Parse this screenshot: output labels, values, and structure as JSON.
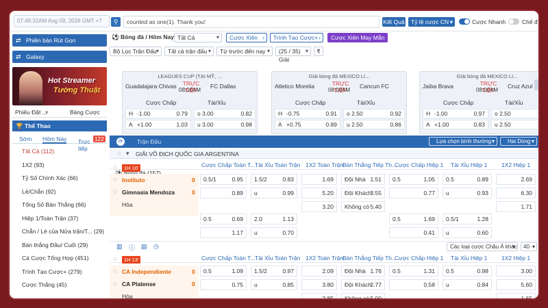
{
  "topbar": {
    "time": "07:46:32AM Aug 09, 2026 GMT +7",
    "search_text": "counted as one(1). Thank you!",
    "results_btn": "Kết Quả",
    "odds_select": "Tỷ lệ cược CN",
    "quick_bet": "Cược Nhanh",
    "mode_label": "Chế đ"
  },
  "sidebar": {
    "btn1": "Phiên bản Rút Gọn",
    "btn2": "Galaxy",
    "banner_line1": "Hot Streamer",
    "banner_line2": "Tường Thuật",
    "tab_slip": "Phiếu Đặt ...",
    "tab_table": "Bảng Cược",
    "sport_header": "Thể Thao",
    "subtab_early": "Sớm",
    "subtab_today": "Hôm Nay",
    "subtab_live": "Trực tiếp",
    "live_badge": "122",
    "menu": [
      {
        "label": "Bóng đá (157)",
        "kind": "main"
      },
      {
        "label": "Tất Cả (112)",
        "kind": "sub"
      },
      {
        "label": "1X2 (93)",
        "kind": "item"
      },
      {
        "label": "Tỷ Số Chính Xác (66)",
        "kind": "item"
      },
      {
        "label": "Lẻ/Chẵn (92)",
        "kind": "item"
      },
      {
        "label": "Tổng Số Bàn Thắng (66)",
        "kind": "item"
      },
      {
        "label": "Hiệp 1/Toàn Trận (37)",
        "kind": "item"
      },
      {
        "label": "Chẵn / Lẻ của Nửa trận/T... (29)",
        "kind": "item"
      },
      {
        "label": "Bàn thắng Đầu/ Cuối (29)",
        "kind": "item"
      },
      {
        "label": "Cá Cược Tổng Hợp (451)",
        "kind": "item"
      },
      {
        "label": "Trình Tạo Cược+ (279)",
        "kind": "item"
      },
      {
        "label": "Cược Thắng (45)",
        "kind": "item"
      }
    ]
  },
  "main": {
    "title": "Bóng đá / Hôm Nay",
    "filter_all": "Tất Cả",
    "btn_parlay": "Cược Xiên",
    "btn_builder": "Trình Tạo Cược+",
    "btn_lucky": "Cược Xiên May Mắn",
    "filter_match": "Bộ Lọc Trận Đấu",
    "filter_all_matches": "Tất cả trận đấu",
    "sort_time": "Từ trước đến nay",
    "count": "(25 / 35) Giải",
    "money_icon": "₹"
  },
  "cards": [
    {
      "league": "LEAGUES CUP (TẠI MỸ, ...",
      "home": "Guadalajara Chivas",
      "away": "FC Dallas",
      "live": "TRỰC TIẾP",
      "time": "08:00AM",
      "hdr_hcp": "Cược Chấp",
      "hdr_ou": "Tài/Xỉu",
      "h_label": "H",
      "h_hcp": "-1.00",
      "h_hcp_odds": "0.79",
      "h_ou": "o 3.00",
      "h_ou_odds": "0.82",
      "a_label": "A",
      "a_hcp": "+1.00",
      "a_hcp_odds": "1.03",
      "a_ou": "u 3.00",
      "a_ou_odds": "0.98"
    },
    {
      "league": "Giải bóng đá MEXICO LI...",
      "home": "Atletico Morelia",
      "away": "Cancun FC",
      "live": "TRỰC TIẾP",
      "time": "08:00AM",
      "hdr_hcp": "Cược Chấp",
      "hdr_ou": "Tài/Xỉu",
      "h_label": "H",
      "h_hcp": "-0.75",
      "h_hcp_odds": "0.91",
      "h_ou": "o 2.50",
      "h_ou_odds": "0.92",
      "a_label": "A",
      "a_hcp": "+0.75",
      "a_hcp_odds": "0.89",
      "a_ou": "u 2.50",
      "a_ou_odds": "0.86"
    },
    {
      "league": "Giải bóng đá MEXICO LI...",
      "home": "Jaiba Brava",
      "away": "Cruz Azul Hidalgo",
      "live": "TRỰC TIẾP",
      "time": "08:00AM",
      "hdr_hcp": "Cược Chấp",
      "hdr_ou": "Tài/Xỉu",
      "h_label": "H",
      "h_hcp": "-1.00",
      "h_hcp_odds": "0.97",
      "h_ou": "o 2.50",
      "h_ou_odds": "0.9",
      "a_label": "A",
      "a_hcp": "+1.00",
      "a_hcp_odds": "0.83",
      "a_ou": "u 2.50",
      "a_ou_odds": "0.9"
    }
  ],
  "table": {
    "section_label": "Trận Đấu",
    "sort_select": "Lựa chọn bình thường",
    "line_select": "Hai Dòng",
    "league": "GIẢI VÔ ĐỊCH QUỐC GIA ARGENTINA",
    "other_select": "Các loại cược Châu Á khác",
    "page_size": "40",
    "cols": [
      "Cược Chấp Toàn T...",
      "Tài Xỉu Toàn Trận",
      "1X2 Toàn Trận",
      "Bàn Thắng Tiếp Th...",
      "Cược Chấp Hiệp 1",
      "Tài Xỉu Hiệp 1",
      "1X2 Hiệp 1"
    ],
    "match1": {
      "tag": "1H 16'",
      "home": "Instituto",
      "away": "Gimnasia Mendoza",
      "draw": "Hòa",
      "home_score": "0",
      "away_score": "0",
      "r1": [
        "0.5/1",
        "0.95",
        "1.5/2",
        "0.83",
        "1.69",
        "Đội Nhà",
        "1.51",
        "0.5",
        "1.05",
        "0.5",
        "0.89",
        "2.69"
      ],
      "r2": [
        "",
        "0.89",
        "u",
        "0.99",
        "5.20",
        "Đội Khách",
        "3.55",
        "",
        "0.77",
        "u",
        "0.93",
        "6.30"
      ],
      "r3": [
        "3.20",
        "Không có",
        "5.40",
        "1.71"
      ],
      "r4": [
        "0.5",
        "0.69",
        "2.0",
        "1.13",
        "0.5",
        "1.69",
        "0.5/1",
        "1.28"
      ],
      "r5": [
        "",
        "1.17",
        "u",
        "0.70",
        "",
        "0.41",
        "u",
        "0.60"
      ]
    },
    "match2": {
      "tag": "1H 13'",
      "home": "CA Independiente",
      "away": "CA Platense",
      "draw": "Hòa",
      "home_score": "0",
      "away_score": "0",
      "r1": [
        "0.5",
        "1.09",
        "1.5/2",
        "0.97",
        "2.09",
        "Đội Nhà",
        "1.76",
        "0.5",
        "1.31",
        "0.5",
        "0.98",
        "3.00"
      ],
      "r2": [
        "",
        "0.75",
        "u",
        "0.85",
        "3.80",
        "Đội Khách",
        "2.77",
        "",
        "0.58",
        "u",
        "0.84",
        "5.60"
      ],
      "r3": [
        "2.85",
        "Không có",
        "5.00",
        "1.65"
      ]
    }
  }
}
